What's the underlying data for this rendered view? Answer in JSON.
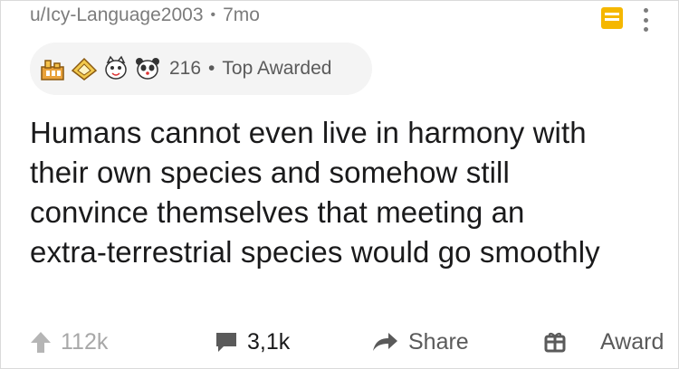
{
  "post": {
    "author": "u/Icy-Language2003",
    "separator": "•",
    "age": "7mo",
    "awards": {
      "icons": [
        "gold-trophy-award-icon",
        "gold-hands-award-icon",
        "cat-face-award-icon",
        "panda-face-award-icon"
      ],
      "count": "216",
      "separator": "•",
      "label": "Top Awarded"
    },
    "title": "Humans cannot even live in harmony with their own species and somehow still convince themselves that meeting an extra-terrestrial species would go smoothly"
  },
  "actions": {
    "upvotes": "112k",
    "comments": "3,1k",
    "share_label": "Share",
    "award_label": "Award"
  },
  "colors": {
    "save_accent": "#f5b700",
    "muted_text": "#7c7c7c",
    "award_pill_bg": "#f4f4f4"
  }
}
